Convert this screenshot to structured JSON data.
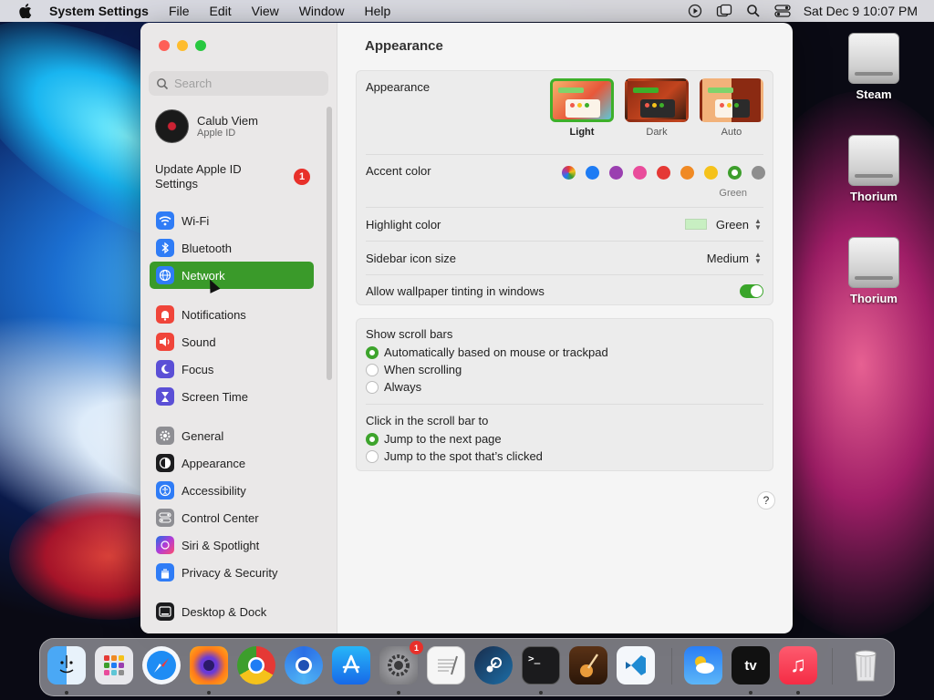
{
  "menubar": {
    "app_name": "System Settings",
    "menus": [
      "File",
      "Edit",
      "View",
      "Window",
      "Help"
    ],
    "datetime": "Sat Dec 9  10:07 PM"
  },
  "desktop": {
    "icons": [
      {
        "label": "Steam"
      },
      {
        "label": "Thorium"
      },
      {
        "label": "Thorium"
      }
    ]
  },
  "sidebar": {
    "search_placeholder": "Search",
    "profile": {
      "name": "Calub Viem",
      "subtitle": "Apple ID"
    },
    "update": {
      "label": "Update Apple ID Settings",
      "badge": "1"
    },
    "items": [
      {
        "label": "Wi-Fi",
        "icon": "wifi-icon",
        "color": "#2f7cf6"
      },
      {
        "label": "Bluetooth",
        "icon": "bluetooth-icon",
        "color": "#2f7cf6"
      },
      {
        "label": "Network",
        "icon": "globe-icon",
        "color": "#2f7cf6",
        "selected": true
      },
      {
        "label": "Notifications",
        "icon": "bell-icon",
        "color": "#f0453a"
      },
      {
        "label": "Sound",
        "icon": "speaker-icon",
        "color": "#f0453a"
      },
      {
        "label": "Focus",
        "icon": "moon-icon",
        "color": "#5b4fd6"
      },
      {
        "label": "Screen Time",
        "icon": "hourglass-icon",
        "color": "#5b4fd6"
      },
      {
        "label": "General",
        "icon": "gear-icon",
        "color": "#8e8e93"
      },
      {
        "label": "Appearance",
        "icon": "appearance-icon",
        "color": "#1c1c1e"
      },
      {
        "label": "Accessibility",
        "icon": "accessibility-icon",
        "color": "#2f7cf6"
      },
      {
        "label": "Control Center",
        "icon": "control-center-icon",
        "color": "#8e8e93"
      },
      {
        "label": "Siri & Spotlight",
        "icon": "siri-icon",
        "color": "#b23bd6"
      },
      {
        "label": "Privacy & Security",
        "icon": "hand-icon",
        "color": "#2f7cf6"
      },
      {
        "label": "Desktop & Dock",
        "icon": "dock-icon",
        "color": "#1c1c1e"
      }
    ]
  },
  "content": {
    "title": "Appearance",
    "appearance": {
      "label": "Appearance",
      "options": [
        {
          "label": "Light",
          "selected": true
        },
        {
          "label": "Dark",
          "selected": false
        },
        {
          "label": "Auto",
          "selected": false
        }
      ]
    },
    "accent": {
      "label": "Accent color",
      "colors": [
        "multicolor",
        "#1e7cf4",
        "#9a3fb0",
        "#e94c9b",
        "#e53935",
        "#f08a24",
        "#f5c21b",
        "#3d9e2c",
        "#8e8e8e"
      ],
      "selected_name": "Green"
    },
    "highlight": {
      "label": "Highlight color",
      "value": "Green",
      "swatch": "#c8efc2"
    },
    "sidebar_icon_size": {
      "label": "Sidebar icon size",
      "value": "Medium"
    },
    "wallpaper_tinting": {
      "label": "Allow wallpaper tinting in windows",
      "on": true
    },
    "scroll_bars": {
      "label": "Show scroll bars",
      "options": [
        {
          "label": "Automatically based on mouse or trackpad",
          "selected": true
        },
        {
          "label": "When scrolling",
          "selected": false
        },
        {
          "label": "Always",
          "selected": false
        }
      ]
    },
    "click_scroll": {
      "label": "Click in the scroll bar to",
      "options": [
        {
          "label": "Jump to the next page",
          "selected": true
        },
        {
          "label": "Jump to the spot that’s clicked",
          "selected": false
        }
      ]
    },
    "help": "?"
  },
  "dock": {
    "apps": [
      "Finder",
      "Launchpad",
      "Safari",
      "Firefox",
      "Chrome",
      "Thorium",
      "App Store",
      "System Settings",
      "TextEdit",
      "Steam",
      "Terminal",
      "GarageBand",
      "Visual Studio Code",
      "Weather",
      "Apple TV",
      "Music",
      "Trash"
    ],
    "settings_badge": "1"
  }
}
